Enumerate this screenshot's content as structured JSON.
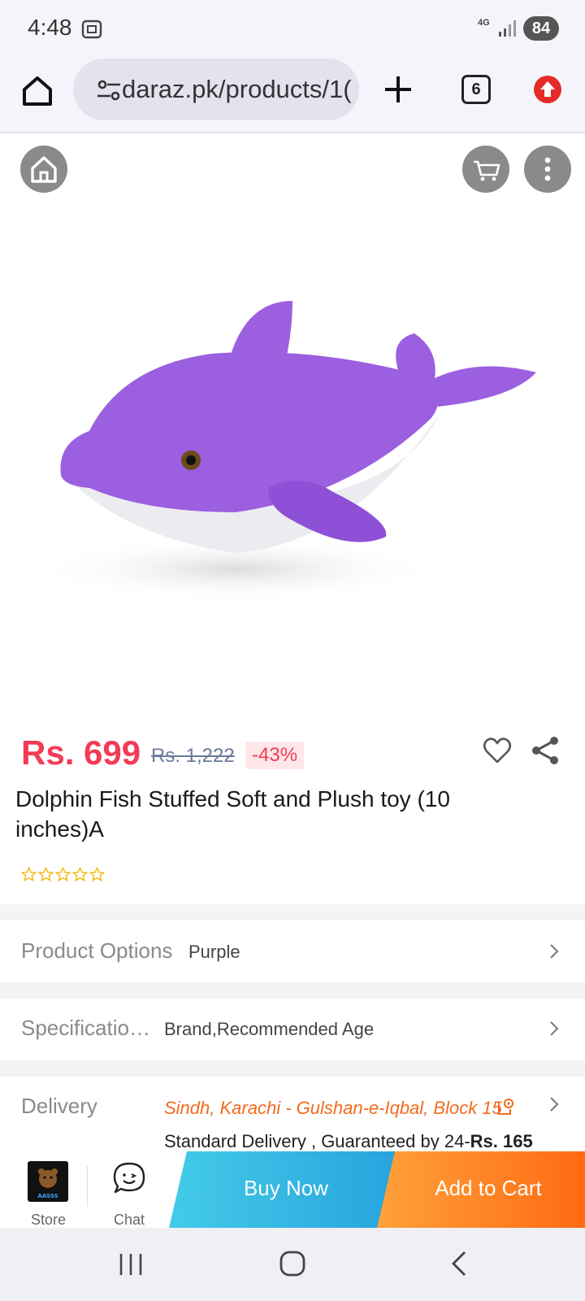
{
  "status_bar": {
    "time": "4:48",
    "network": "4G",
    "battery": "84"
  },
  "browser": {
    "url": "daraz.pk/products/1(",
    "tab_count": "6"
  },
  "product": {
    "price": "Rs. 699",
    "original_price": "Rs. 1,222",
    "discount": "-43%",
    "title": "Dolphin Fish Stuffed Soft and Plush toy (10 inches)A",
    "rating": 0,
    "max_rating": 5
  },
  "options": {
    "label": "Product Options",
    "value": "Purple"
  },
  "specifications": {
    "label": "Specificatio…",
    "value": "Brand,Recommended Age"
  },
  "delivery": {
    "label": "Delivery",
    "location": "Sindh, Karachi - Gulshan-e-Iqbal, Block 15",
    "standard_text": "Standard Delivery , Guaranteed by 24-",
    "fee": "Rs. 165"
  },
  "actions": {
    "store_label": "Store",
    "chat_label": "Chat",
    "buy_now": "Buy Now",
    "add_to_cart": "Add to Cart",
    "store_logo_text": "AASSS"
  },
  "colors": {
    "price": "#f23b56",
    "buy_now": "#26a3de",
    "add_to_cart": "#ff6a12",
    "delivery_location": "#f26b1d",
    "star": "#f5b301",
    "product_toy": "#9b5fe0"
  },
  "icons": {
    "browser": [
      "home-icon",
      "site-settings-icon",
      "plus-icon",
      "tabs-icon",
      "update-icon"
    ],
    "product": [
      "home-icon",
      "cart-icon",
      "more-icon",
      "heart-icon",
      "share-icon"
    ],
    "nav": [
      "recents-icon",
      "home-icon",
      "back-icon"
    ]
  }
}
